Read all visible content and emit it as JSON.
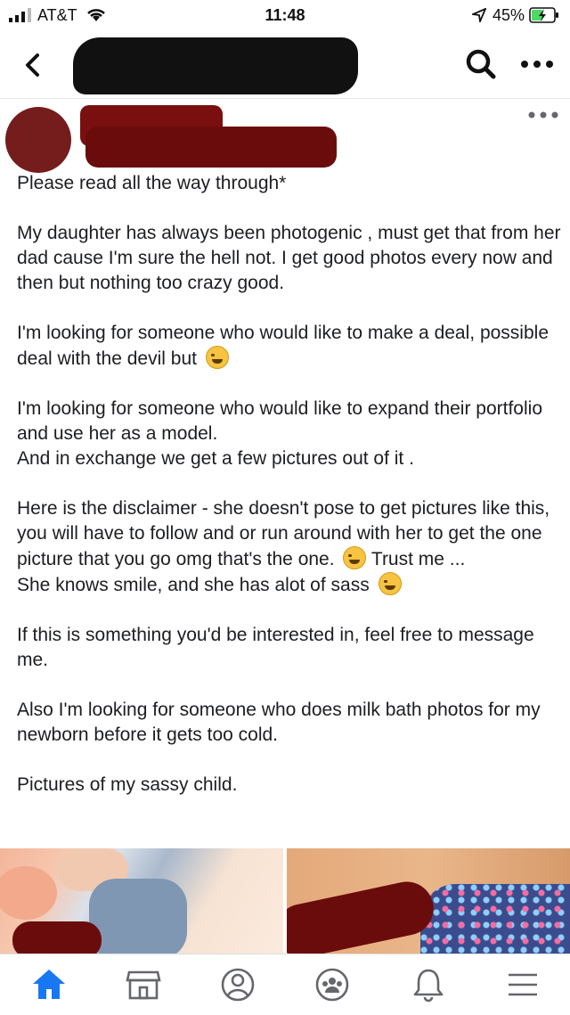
{
  "status_bar": {
    "carrier": "AT&T",
    "time": "11:48",
    "battery": "45%",
    "icons": [
      "signal-icon",
      "wifi-icon",
      "location-icon",
      "battery-charging-icon"
    ]
  },
  "top_bar": {
    "icons": [
      "back-chevron-icon",
      "search-icon",
      "more-dots-icon"
    ]
  },
  "post": {
    "paragraphs": [
      "Please read all the way through*",
      "My daughter has always been photogenic , must get that from her dad cause I'm sure the hell not. I get good photos every now and then but nothing too crazy good.",
      "I'm looking for someone who would like to make a deal, possible deal with the devil but",
      "I'm looking for someone who would like to expand their portfolio and use her as a model.\nAnd in exchange we get a few pictures out of it .",
      "Here is the disclaimer - she doesn't pose to get pictures like this, you will have to follow and or run around with her to get the one picture that you go omg that's the one.",
      "Trust me ...",
      "She knows smile, and she has alot of sass",
      "If this is something you'd be interested in, feel free to message me.",
      "Also I'm looking for someone who does milk bath photos for my newborn before it gets too cold.",
      "Pictures of my sassy child."
    ],
    "emojis": [
      "rofl-emoji",
      "rofl-emoji",
      "woozy-face-emoji"
    ]
  },
  "tab_bar": {
    "items": [
      "home-icon",
      "marketplace-icon",
      "profile-icon",
      "groups-icon",
      "notifications-bell-icon",
      "menu-icon"
    ],
    "active_color": "#1877f2",
    "inactive_color": "#65676b"
  }
}
